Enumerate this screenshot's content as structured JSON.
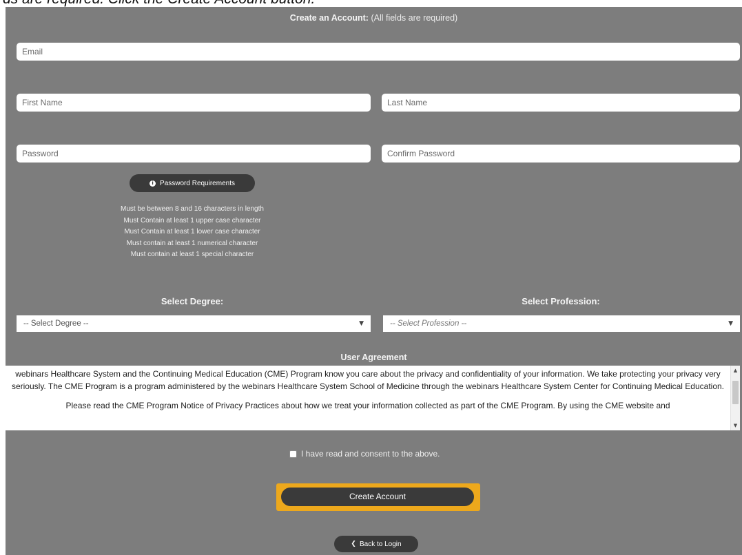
{
  "banner": {
    "text": "ds are required. Click the Create Account button."
  },
  "form": {
    "title_bold": "Create an Account:",
    "title_note": "(All fields are required)"
  },
  "fields": {
    "email": "Email",
    "first_name": "First Name",
    "last_name": "Last Name",
    "password": "Password",
    "confirm_password": "Confirm Password"
  },
  "password_requirements": {
    "button_label": "Password Requirements",
    "items": [
      "Must be between 8 and 16 characters in length",
      "Must Contain at least 1 upper case character",
      "Must Contain at least 1 lower case character",
      "Must contain at least 1 numerical character",
      "Must contain at least 1 special character"
    ]
  },
  "degree": {
    "label": "Select Degree:",
    "selected": "-- Select Degree --"
  },
  "profession": {
    "label": "Select Profession:",
    "selected": "-- Select Profession --"
  },
  "agreement": {
    "title": "User Agreement",
    "paragraph_1": "webinars Healthcare System and the Continuing Medical Education (CME) Program know you care about the privacy and confidentiality of your information. We take protecting your privacy very seriously. The CME Program is a program administered by the webinars Healthcare System School of Medicine through the webinars Healthcare System Center for Continuing Medical Education.",
    "paragraph_2": "Please read the CME Program Notice of Privacy Practices about how we treat your information collected as part of the CME Program. By using the CME website and"
  },
  "consent": {
    "label": "I have read and consent to the above.",
    "checked": false
  },
  "buttons": {
    "create_account": "Create Account",
    "back_to_login": "Back to Login"
  },
  "colors": {
    "panel_background": "#7d7d7d",
    "button_dark": "#3a3a3a",
    "highlight_frame": "#eda81c"
  }
}
